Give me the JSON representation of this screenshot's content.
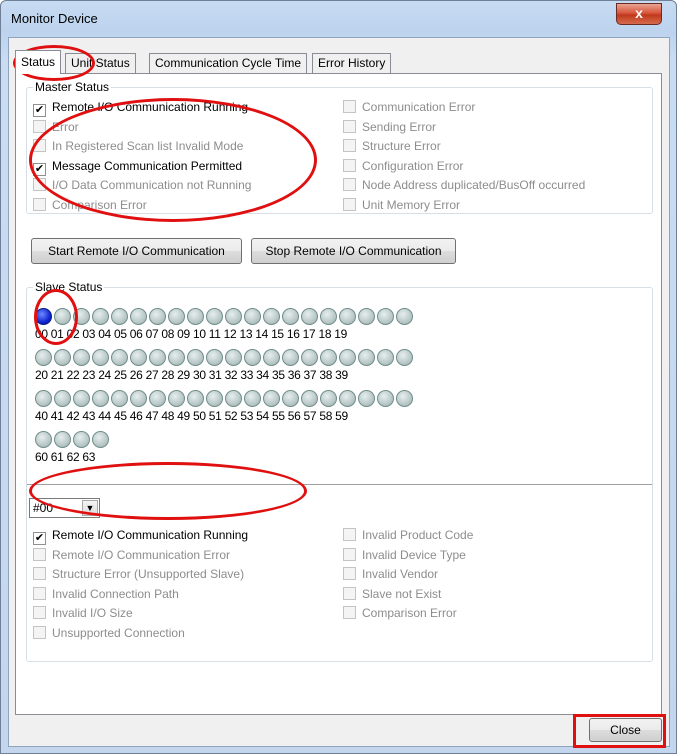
{
  "window": {
    "title": "Monitor Device",
    "close_glyph": "x"
  },
  "tabs": [
    {
      "label": "Status"
    },
    {
      "label": "Unit Status"
    },
    {
      "label": "Communication Cycle Time"
    },
    {
      "label": "Error History"
    }
  ],
  "master_status": {
    "legend": "Master Status",
    "left": [
      {
        "label": "Remote I/O Communication Running",
        "checked": true,
        "enabled": true
      },
      {
        "label": "Error",
        "checked": false,
        "enabled": false
      },
      {
        "label": "In Registered Scan list Invalid Mode",
        "checked": false,
        "enabled": false
      },
      {
        "label": "Message Communication Permitted",
        "checked": true,
        "enabled": true
      },
      {
        "label": "I/O Data Communication not Running",
        "checked": false,
        "enabled": false
      },
      {
        "label": "Comparison Error",
        "checked": false,
        "enabled": false
      }
    ],
    "right": [
      {
        "label": "Communication Error",
        "checked": false,
        "enabled": false
      },
      {
        "label": "Sending Error",
        "checked": false,
        "enabled": false
      },
      {
        "label": "Structure Error",
        "checked": false,
        "enabled": false
      },
      {
        "label": "Configuration Error",
        "checked": false,
        "enabled": false
      },
      {
        "label": "Node Address duplicated/BusOff occurred",
        "checked": false,
        "enabled": false
      },
      {
        "label": "Unit Memory Error",
        "checked": false,
        "enabled": false
      }
    ]
  },
  "buttons": {
    "start": "Start Remote I/O Communication",
    "stop": "Stop Remote I/O Communication",
    "close": "Close"
  },
  "slave_status": {
    "legend": "Slave Status",
    "active_node": "00",
    "node_rows": [
      [
        "00",
        "01",
        "02",
        "03",
        "04",
        "05",
        "06",
        "07",
        "08",
        "09",
        "10",
        "11",
        "12",
        "13",
        "14",
        "15",
        "16",
        "17",
        "18",
        "19"
      ],
      [
        "20",
        "21",
        "22",
        "23",
        "24",
        "25",
        "26",
        "27",
        "28",
        "29",
        "30",
        "31",
        "32",
        "33",
        "34",
        "35",
        "36",
        "37",
        "38",
        "39"
      ],
      [
        "40",
        "41",
        "42",
        "43",
        "44",
        "45",
        "46",
        "47",
        "48",
        "49",
        "50",
        "51",
        "52",
        "53",
        "54",
        "55",
        "56",
        "57",
        "58",
        "59"
      ],
      [
        "60",
        "61",
        "62",
        "63"
      ]
    ],
    "selected_slave": "#00",
    "left": [
      {
        "label": "Remote I/O Communication Running",
        "checked": true,
        "enabled": true
      },
      {
        "label": "Remote I/O Communication Error",
        "checked": false,
        "enabled": false
      },
      {
        "label": "Structure Error (Unsupported Slave)",
        "checked": false,
        "enabled": false
      },
      {
        "label": "Invalid Connection Path",
        "checked": false,
        "enabled": false
      },
      {
        "label": "Invalid I/O Size",
        "checked": false,
        "enabled": false
      },
      {
        "label": "Unsupported Connection",
        "checked": false,
        "enabled": false
      }
    ],
    "right": [
      {
        "label": "Invalid Product Code",
        "checked": false,
        "enabled": false
      },
      {
        "label": "Invalid Device Type",
        "checked": false,
        "enabled": false
      },
      {
        "label": "Invalid Vendor",
        "checked": false,
        "enabled": false
      },
      {
        "label": "Slave not Exist",
        "checked": false,
        "enabled": false
      },
      {
        "label": "Comparison Error",
        "checked": false,
        "enabled": false
      }
    ]
  },
  "colors": {
    "annotation": "#e01010",
    "active_led": "#1026d4"
  }
}
